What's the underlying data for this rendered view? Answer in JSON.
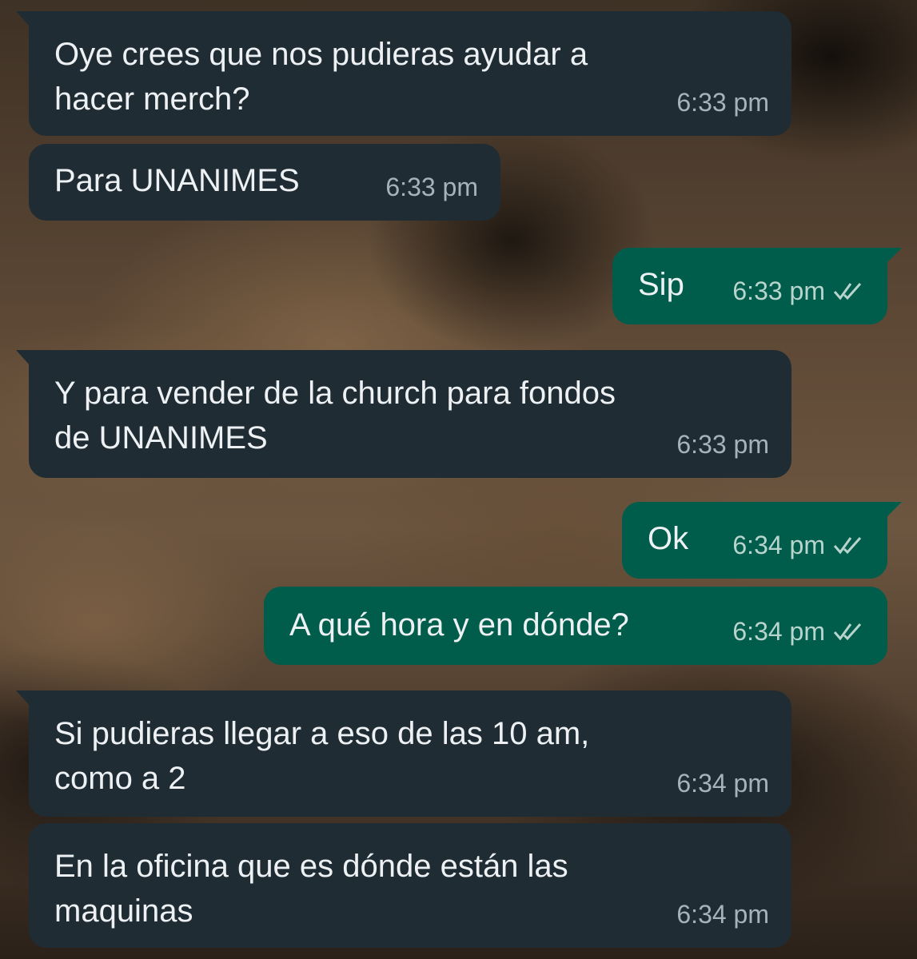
{
  "messages": [
    {
      "direction": "in",
      "text": "Oye crees que nos pudieras ayudar a\nhacer merch?",
      "time": "6:33 pm"
    },
    {
      "direction": "in",
      "text": "Para UNANIMES",
      "time": "6:33 pm"
    },
    {
      "direction": "out",
      "text": "Sip",
      "time": "6:33 pm",
      "status_icon": "double-check-icon"
    },
    {
      "direction": "in",
      "text": "Y para vender de la church para fondos\nde UNANIMES",
      "time": "6:33 pm"
    },
    {
      "direction": "out",
      "text": "Ok",
      "time": "6:34 pm",
      "status_icon": "double-check-icon"
    },
    {
      "direction": "out",
      "text": "A qué hora y en dónde?",
      "time": "6:34 pm",
      "status_icon": "double-check-icon"
    },
    {
      "direction": "in",
      "text": "Si pudieras llegar a eso de las 10 am,\ncomo a 2",
      "time": "6:34 pm"
    },
    {
      "direction": "in",
      "text": "En la oficina que es dónde están las\nmaquinas",
      "time": "6:34 pm"
    }
  ],
  "colors": {
    "incoming_bubble": "#1f2c34",
    "outgoing_bubble": "#005c4b",
    "text": "#eef1f3",
    "timestamp": "#a7b3ba"
  }
}
